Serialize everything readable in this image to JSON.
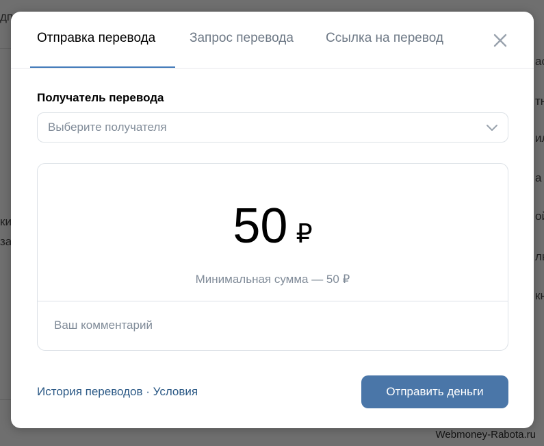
{
  "background": {
    "fragments": {
      "top_left": "дп",
      "mid_left_1": "ки",
      "mid_left_2": "за",
      "right_1": "ас",
      "right_2": "тн",
      "right_3": "ил",
      "right_4": "а",
      "right_5": "ой",
      "right_6": "ль",
      "right_7": "кн"
    },
    "watermark": "Webmoney-Rabota.ru"
  },
  "modal": {
    "tabs": [
      {
        "label": "Отправка перевода",
        "active": true
      },
      {
        "label": "Запрос перевода",
        "active": false
      },
      {
        "label": "Ссылка на перевод",
        "active": false
      }
    ],
    "close_icon": "close-icon",
    "recipient": {
      "label": "Получатель перевода",
      "placeholder": "Выберите получателя",
      "chevron_icon": "chevron-down-icon"
    },
    "amount": {
      "value": "50",
      "currency": "₽",
      "min_note": "Минимальная сумма — 50 ₽"
    },
    "comment": {
      "placeholder": "Ваш комментарий"
    },
    "footer": {
      "history_link": "История переводов",
      "separator": " · ",
      "terms_link": "Условия",
      "send_button": "Отправить деньги"
    }
  },
  "colors": {
    "accent": "#447bba",
    "button": "#4a76a8",
    "link": "#2a5885",
    "muted_text": "#818c99",
    "tab_inactive": "#6d7885",
    "overlay": "#6f6f6f"
  }
}
